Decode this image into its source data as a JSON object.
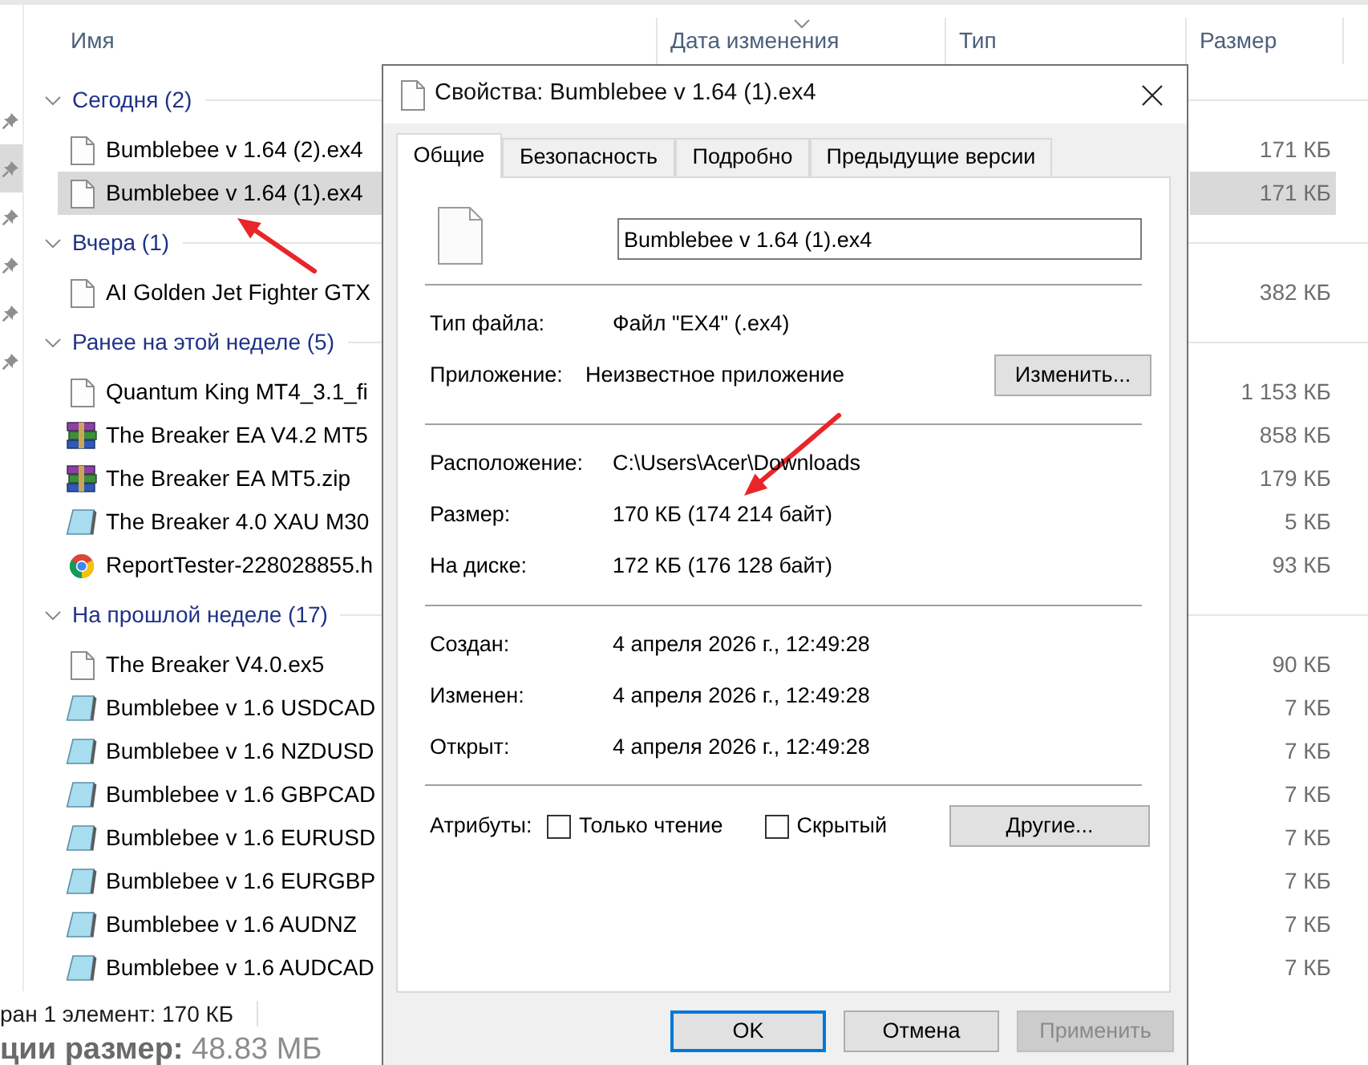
{
  "explorer": {
    "nav_items": [
      {
        "selected": false
      },
      {
        "selected": true
      },
      {
        "selected": false
      },
      {
        "selected": false
      },
      {
        "selected": false
      },
      {
        "selected": false
      }
    ],
    "columns": [
      {
        "label": "Имя",
        "sorted": false
      },
      {
        "label": "Дата изменения",
        "sorted": true
      },
      {
        "label": "Тип",
        "sorted": false
      },
      {
        "label": "Размер",
        "sorted": false
      }
    ],
    "groups": [
      {
        "label": "Сегодня (2)",
        "expanded": true,
        "files": [
          {
            "kind": "file",
            "name": "Bumblebee v 1.64 (2).ex4",
            "size": "171 КБ",
            "selected": false
          },
          {
            "kind": "file",
            "name": "Bumblebee v 1.64 (1).ex4",
            "size": "171 КБ",
            "selected": true
          }
        ]
      },
      {
        "label": "Вчера (1)",
        "expanded": true,
        "files": [
          {
            "kind": "file",
            "name": "AI Golden Jet Fighter GTX",
            "size": "382 КБ",
            "selected": false
          }
        ]
      },
      {
        "label": "Ранее на этой неделе (5)",
        "expanded": true,
        "files": [
          {
            "kind": "file",
            "name": "Quantum King MT4_3.1_fi",
            "size": "1 153 КБ",
            "selected": false
          },
          {
            "kind": "archive",
            "name": "The Breaker EA V4.2 MT5",
            "size": "858 КБ",
            "selected": false
          },
          {
            "kind": "archive",
            "name": "The Breaker EA MT5.zip",
            "size": "179 КБ",
            "selected": false
          },
          {
            "kind": "text",
            "name": "The Breaker 4.0 XAU M30",
            "size": "5 КБ",
            "selected": false
          },
          {
            "kind": "html",
            "name": "ReportTester-228028855.h",
            "size": "93 КБ",
            "selected": false
          }
        ]
      },
      {
        "label": "На прошлой неделе (17)",
        "expanded": true,
        "files": [
          {
            "kind": "file",
            "name": "The Breaker V4.0.ex5",
            "size": "90 КБ",
            "selected": false
          },
          {
            "kind": "text",
            "name": "Bumblebee v 1.6 USDCAD",
            "size": "7 КБ",
            "selected": false
          },
          {
            "kind": "text",
            "name": "Bumblebee v 1.6 NZDUSD",
            "size": "7 КБ",
            "selected": false
          },
          {
            "kind": "text",
            "name": "Bumblebee v 1.6 GBPCAD",
            "size": "7 КБ",
            "selected": false
          },
          {
            "kind": "text",
            "name": "Bumblebee v 1.6 EURUSD",
            "size": "7 КБ",
            "selected": false
          },
          {
            "kind": "text",
            "name": "Bumblebee v 1.6 EURGBP",
            "size": "7 КБ",
            "selected": false
          },
          {
            "kind": "text",
            "name": "Bumblebee v 1.6 AUDNZ",
            "size": "7 КБ",
            "selected": false
          },
          {
            "kind": "text",
            "name": "Bumblebee v 1.6 AUDCAD",
            "size": "7 КБ",
            "selected": false
          }
        ]
      }
    ],
    "status": "ран 1 элемент: 170 КБ"
  },
  "underlying_text": "**ции размер:** 48.83 МБ",
  "dialog": {
    "title": "Свойства: Bumblebee v 1.64 (1).ex4",
    "tabs": [
      {
        "label": "Общие",
        "selected": true
      },
      {
        "label": "Безопасность",
        "selected": false
      },
      {
        "label": "Подробно",
        "selected": false
      },
      {
        "label": "Предыдущие версии",
        "selected": false
      }
    ],
    "file_name": "Bumblebee v 1.64 (1).ex4",
    "type": {
      "label": "Тип файла:",
      "value": "Файл \"EX4\" (.ex4)"
    },
    "application": {
      "label": "Приложение:",
      "value": "Неизвестное приложение",
      "button": "Изменить..."
    },
    "location": [
      {
        "label": "Расположение:",
        "value": "C:\\Users\\Acer\\Downloads"
      },
      {
        "label": "Размер:",
        "value": "170 КБ (174 214 байт)"
      },
      {
        "label": "На диске:",
        "value": "172 КБ (176 128 байт)"
      }
    ],
    "dates": [
      {
        "label": "Создан:",
        "value": "4 апреля 2026 г., 12:49:28"
      },
      {
        "label": "Изменен:",
        "value": "4 апреля 2026 г., 12:49:28"
      },
      {
        "label": "Открыт:",
        "value": "4 апреля 2026 г., 12:49:28"
      }
    ],
    "attributes": {
      "label": "Атрибуты:",
      "options": [
        {
          "label": "Только чтение",
          "checked": false
        },
        {
          "label": "Скрытый",
          "checked": false
        }
      ],
      "button": "Другие..."
    },
    "buttons": [
      {
        "label": "OK",
        "default": true,
        "disabled": false
      },
      {
        "label": "Отмена",
        "default": false,
        "disabled": false
      },
      {
        "label": "Применить",
        "default": false,
        "disabled": true
      }
    ]
  }
}
